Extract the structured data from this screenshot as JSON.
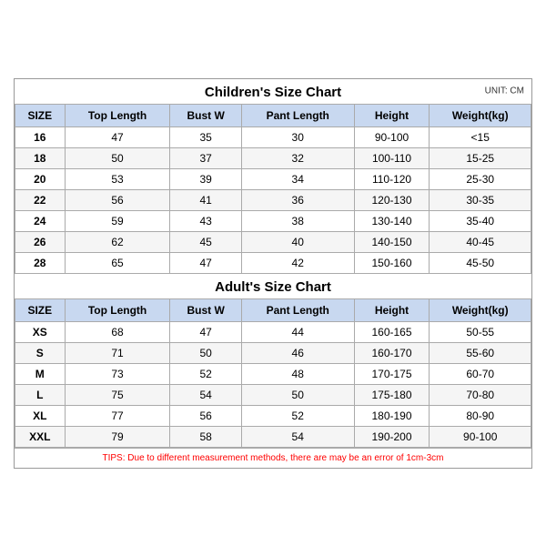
{
  "children_title": "Children's Size Chart",
  "adults_title": "Adult's Size Chart",
  "unit": "UNIT: CM",
  "columns": [
    "SIZE",
    "Top Length",
    "Bust W",
    "Pant Length",
    "Height",
    "Weight(kg)"
  ],
  "children_rows": [
    {
      "size": "16",
      "top_length": "47",
      "bust_w": "35",
      "pant_length": "30",
      "height": "90-100",
      "weight": "<15"
    },
    {
      "size": "18",
      "top_length": "50",
      "bust_w": "37",
      "pant_length": "32",
      "height": "100-110",
      "weight": "15-25"
    },
    {
      "size": "20",
      "top_length": "53",
      "bust_w": "39",
      "pant_length": "34",
      "height": "110-120",
      "weight": "25-30"
    },
    {
      "size": "22",
      "top_length": "56",
      "bust_w": "41",
      "pant_length": "36",
      "height": "120-130",
      "weight": "30-35"
    },
    {
      "size": "24",
      "top_length": "59",
      "bust_w": "43",
      "pant_length": "38",
      "height": "130-140",
      "weight": "35-40"
    },
    {
      "size": "26",
      "top_length": "62",
      "bust_w": "45",
      "pant_length": "40",
      "height": "140-150",
      "weight": "40-45"
    },
    {
      "size": "28",
      "top_length": "65",
      "bust_w": "47",
      "pant_length": "42",
      "height": "150-160",
      "weight": "45-50"
    }
  ],
  "adults_rows": [
    {
      "size": "XS",
      "top_length": "68",
      "bust_w": "47",
      "pant_length": "44",
      "height": "160-165",
      "weight": "50-55"
    },
    {
      "size": "S",
      "top_length": "71",
      "bust_w": "50",
      "pant_length": "46",
      "height": "160-170",
      "weight": "55-60"
    },
    {
      "size": "M",
      "top_length": "73",
      "bust_w": "52",
      "pant_length": "48",
      "height": "170-175",
      "weight": "60-70"
    },
    {
      "size": "L",
      "top_length": "75",
      "bust_w": "54",
      "pant_length": "50",
      "height": "175-180",
      "weight": "70-80"
    },
    {
      "size": "XL",
      "top_length": "77",
      "bust_w": "56",
      "pant_length": "52",
      "height": "180-190",
      "weight": "80-90"
    },
    {
      "size": "XXL",
      "top_length": "79",
      "bust_w": "58",
      "pant_length": "54",
      "height": "190-200",
      "weight": "90-100"
    }
  ],
  "tips": "TIPS: Due to different measurement methods, there are may be an error of 1cm-3cm"
}
